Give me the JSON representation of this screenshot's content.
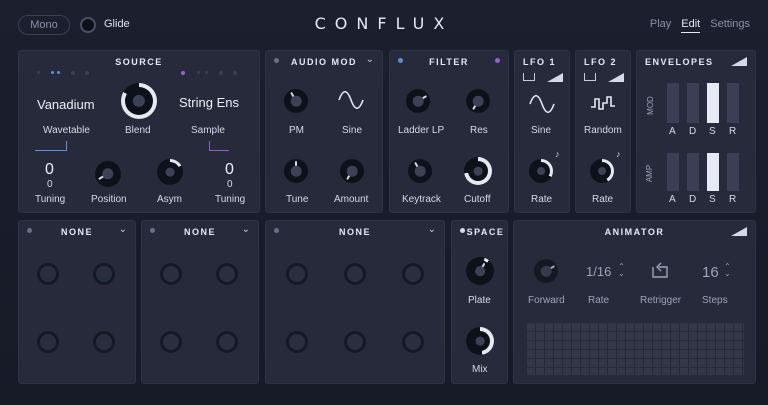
{
  "header": {
    "mono": "Mono",
    "glide": "Glide",
    "logo": "CONFLUX",
    "nav": [
      "Play",
      "Edit",
      "Settings"
    ]
  },
  "source": {
    "title": "SOURCE",
    "left_wave": "Vanadium",
    "left_type": "Wavetable",
    "blend": "Blend",
    "right_wave": "String Ens",
    "right_type": "Sample",
    "tuning_left": "0",
    "tuning_left_fine": "0",
    "tuning_right": "0",
    "tuning_right_fine": "0",
    "tuning_label": "Tuning",
    "position": "Position",
    "asym": "Asym"
  },
  "audio_mod": {
    "title": "AUDIO MOD",
    "pm": "PM",
    "sine": "Sine",
    "tune": "Tune",
    "amount": "Amount"
  },
  "filter": {
    "title": "FILTER",
    "type": "Ladder LP",
    "res": "Res",
    "keytrack": "Keytrack",
    "cutoff": "Cutoff"
  },
  "lfo1": {
    "title": "LFO 1",
    "shape": "Sine",
    "rate": "Rate"
  },
  "lfo2": {
    "title": "LFO 2",
    "shape": "Random",
    "rate": "Rate"
  },
  "envelopes": {
    "title": "ENVELOPES",
    "mod_label": "MOD",
    "amp_label": "AMP",
    "stages": [
      "A",
      "D",
      "S",
      "R"
    ]
  },
  "slots": [
    {
      "title": "NONE"
    },
    {
      "title": "NONE"
    },
    {
      "title": "NONE"
    }
  ],
  "space": {
    "title": "SPACE",
    "plate": "Plate",
    "mix": "Mix"
  },
  "animator": {
    "title": "ANIMATOR",
    "forward": "Forward",
    "rate_value": "1/16",
    "rate": "Rate",
    "retrigger": "Retrigger",
    "steps_value": "16",
    "steps": "Steps"
  },
  "colors": {
    "accent_blue": "#5b8fd9",
    "accent_purple": "#9a5bd9",
    "panel": "#262a3b"
  }
}
